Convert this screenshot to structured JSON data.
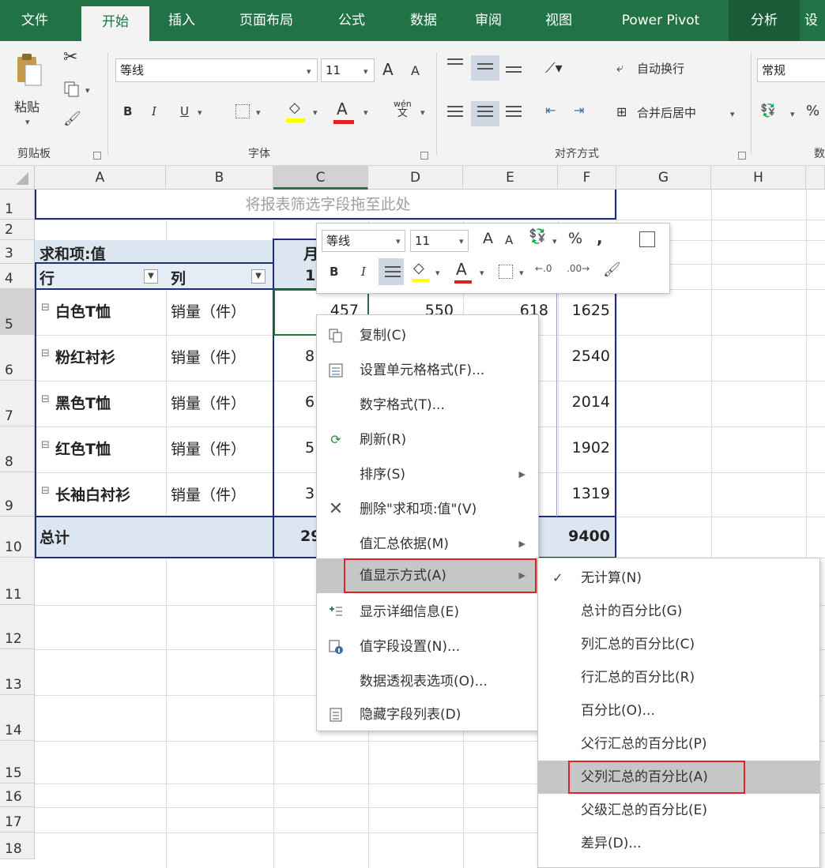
{
  "ribbon_tabs": [
    "文件",
    "开始",
    "插入",
    "页面布局",
    "公式",
    "数据",
    "审阅",
    "视图",
    "Power Pivot",
    "分析",
    "设"
  ],
  "ribbon": {
    "clipboard": {
      "paste_label": "粘贴",
      "group_label": "剪贴板"
    },
    "font": {
      "font_name": "等线",
      "font_size": "11",
      "grow": "A",
      "shrink": "A",
      "bold": "B",
      "italic": "I",
      "underline": "U",
      "phonetic": "wén",
      "phonetic_sub": "文",
      "font_color": "A",
      "group_label": "字体"
    },
    "alignment": {
      "wrap_text": "自动换行",
      "merge_center": "合并后居中",
      "group_label": "对齐方式"
    },
    "number": {
      "format": "常规",
      "percent": "%",
      "group_label": "数"
    }
  },
  "sheet": {
    "columns": [
      "A",
      "B",
      "C",
      "D",
      "E",
      "F",
      "G",
      "H"
    ],
    "rows": [
      "1",
      "2",
      "3",
      "4",
      "5",
      "6",
      "7",
      "8",
      "9",
      "10",
      "11",
      "12",
      "13",
      "14",
      "15",
      "16",
      "17",
      "18"
    ],
    "filter_placeholder": "将报表筛选字段拖至此处",
    "header_values": "求和项:值",
    "header_month": "月",
    "header_row": "行",
    "header_col": "列",
    "header_month_sub": "1",
    "data": [
      {
        "expand": "⊟",
        "name": "白色T恤",
        "measure": "销量（件）",
        "c": "457",
        "d": "550",
        "e": "618",
        "total": "1625"
      },
      {
        "expand": "⊟",
        "name": "粉红衬衫",
        "measure": "销量（件）",
        "c": "8",
        "d": "",
        "e": "",
        "total": "2540"
      },
      {
        "expand": "⊟",
        "name": "黑色T恤",
        "measure": "销量（件）",
        "c": "6",
        "d": "",
        "e": "",
        "total": "2014"
      },
      {
        "expand": "⊟",
        "name": "红色T恤",
        "measure": "销量（件）",
        "c": "5",
        "d": "",
        "e": "",
        "total": "1902"
      },
      {
        "expand": "⊟",
        "name": "长袖白衬衫",
        "measure": "销量（件）",
        "c": "3",
        "d": "",
        "e": "",
        "total": "1319"
      }
    ],
    "grand_total_label": "总计",
    "grand_total_c": "29",
    "grand_total": "9400"
  },
  "mini_toolbar": {
    "font_name": "等线",
    "font_size": "11",
    "grow": "A",
    "shrink": "A",
    "percent": "%",
    "comma": ",",
    "bold": "B",
    "italic": "I",
    "font_color": "A"
  },
  "context_menu": [
    {
      "label": "复制(C)",
      "icon": "copy-icon"
    },
    {
      "label": "设置单元格格式(F)...",
      "icon": "format-cells-icon"
    },
    {
      "label": "数字格式(T)...",
      "icon": ""
    },
    {
      "label": "刷新(R)",
      "icon": "refresh-icon"
    },
    {
      "label": "排序(S)",
      "icon": "",
      "arrow": "▶"
    },
    {
      "label": "删除\"求和项:值\"(V)",
      "icon": "delete-icon"
    },
    {
      "label": "值汇总依据(M)",
      "icon": "",
      "arrow": "▶"
    },
    {
      "label": "值显示方式(A)",
      "icon": "",
      "arrow": "▶"
    },
    {
      "label": "显示详细信息(E)",
      "icon": "show-details-icon"
    },
    {
      "label": "值字段设置(N)...",
      "icon": "value-field-settings-icon"
    },
    {
      "label": "数据透视表选项(O)...",
      "icon": ""
    },
    {
      "label": "隐藏字段列表(D)",
      "icon": "field-list-icon"
    }
  ],
  "submenu": [
    {
      "label": "无计算(N)",
      "checked": "✓"
    },
    {
      "label": "总计的百分比(G)"
    },
    {
      "label": "列汇总的百分比(C)"
    },
    {
      "label": "行汇总的百分比(R)"
    },
    {
      "label": "百分比(O)..."
    },
    {
      "label": "父行汇总的百分比(P)"
    },
    {
      "label": "父列汇总的百分比(A)"
    },
    {
      "label": "父级汇总的百分比(E)"
    },
    {
      "label": "差异(D)..."
    }
  ],
  "colors": {
    "excel_green": "#217346",
    "pivot_band": "#dce6f1",
    "pivot_border": "#1f2d7a",
    "highlight_red": "#d9262c"
  }
}
